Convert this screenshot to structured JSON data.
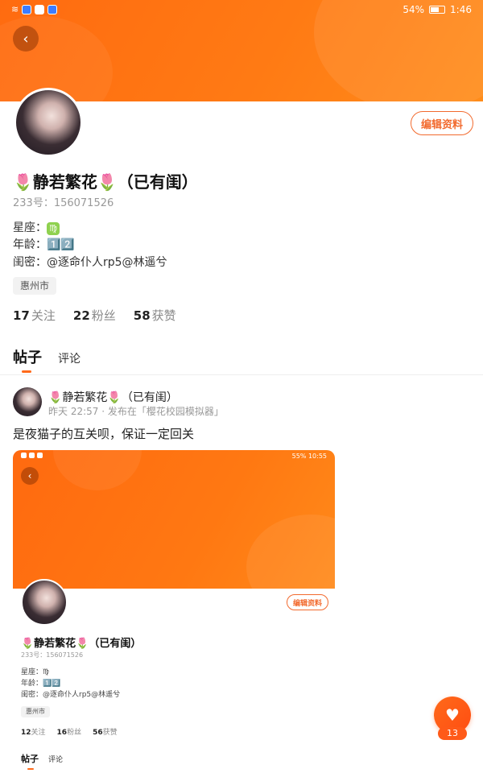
{
  "status_bar": {
    "battery": "54%",
    "time": "1:46"
  },
  "profile": {
    "name": "🌷静若繁花🌷（已有闺）",
    "uid_label": "233号：",
    "uid": "156071526",
    "zodiac_label": "星座：",
    "zodiac_value": "♍",
    "age_label": "年龄：",
    "age_value": "1️⃣2️⃣",
    "bestie_label": "闺密：",
    "bestie_value": "@逐命仆人rp5@林遥兮",
    "location_tag": "惠州市",
    "edit_button": "编辑资料",
    "stats": {
      "following_count": "17",
      "following_label": "关注",
      "followers_count": "22",
      "followers_label": "粉丝",
      "likes_count": "58",
      "likes_label": "获赞"
    }
  },
  "tabs": {
    "posts": "帖子",
    "comments": "评论"
  },
  "post": {
    "author": "🌷静若繁花🌷（已有闺）",
    "meta": "昨天 22:57 · 发布在「樱花校园模拟器」",
    "text": "是夜猫子的互关呗，保证一定回关",
    "image": {
      "status_battery": "55%",
      "status_time": "10:55",
      "edit_button": "编辑资料",
      "name": "🌷静若繁花🌷（已有闺）",
      "uid": "233号：156071526",
      "zodiac": "星座：♍",
      "age": "年龄：1️⃣2️⃣",
      "bestie": "闺密：@逐命仆人rp5@林遥兮",
      "location_tag": "惠州市",
      "following_count": "12",
      "following_label": "关注",
      "followers_count": "16",
      "followers_label": "粉丝",
      "likes_count": "56",
      "likes_label": "获赞",
      "tab_posts": "帖子",
      "tab_comments": "评论"
    }
  },
  "like_fab": {
    "icon": "heart-icon",
    "count": "13"
  }
}
